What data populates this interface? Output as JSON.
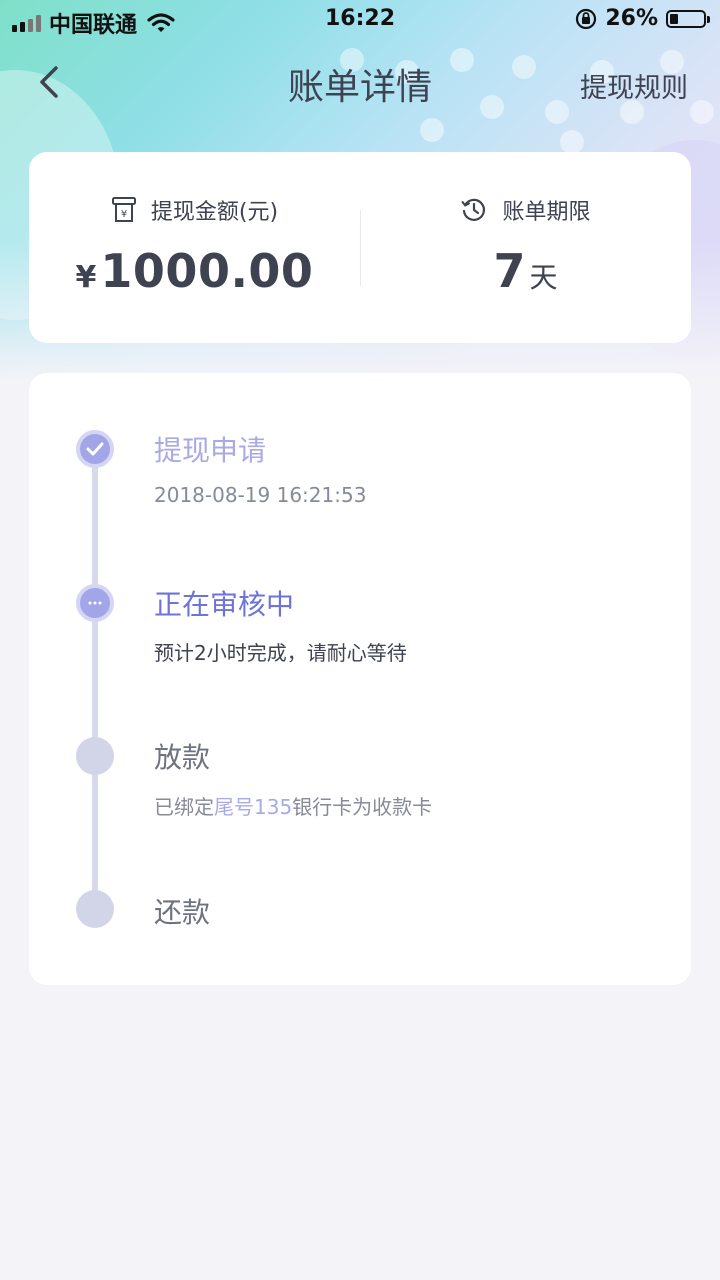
{
  "status_bar": {
    "carrier": "中国联通",
    "time": "16:22",
    "battery": "26%"
  },
  "nav": {
    "title": "账单详情",
    "right_link": "提现规则"
  },
  "summary": {
    "amount_label": "提现金额(元)",
    "currency_symbol": "¥",
    "amount": "1000.00",
    "term_label": "账单期限",
    "term_value": "7",
    "term_unit": "天"
  },
  "timeline": {
    "steps": [
      {
        "title": "提现申请",
        "subtitle": "2018-08-19 16:21:53",
        "state": "done"
      },
      {
        "title": "正在审核中",
        "subtitle": "预计2小时完成，请耐心等待",
        "state": "active"
      },
      {
        "title": "放款",
        "subtitle_prefix": "已绑定",
        "subtitle_highlight": "尾号135",
        "subtitle_suffix": "银行卡为收款卡",
        "state": "pending"
      },
      {
        "title": "还款",
        "state": "pending"
      }
    ]
  },
  "colors": {
    "accent": "#6d73d9",
    "accent_light": "#a8aae6",
    "text_dark": "#3e4251",
    "page_bg": "#f3f3f8"
  },
  "icons": [
    "back-arrow-icon",
    "receipt-yen-icon",
    "clock-icon",
    "check-icon",
    "ellipsis-icon",
    "signal-icon",
    "wifi-icon",
    "orientation-lock-icon",
    "battery-icon"
  ]
}
